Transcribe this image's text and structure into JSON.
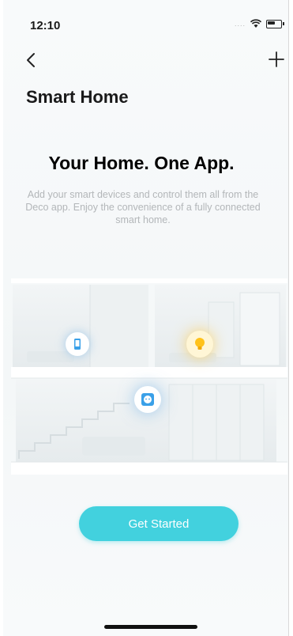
{
  "status_bar": {
    "time": "12:10",
    "signal": "...."
  },
  "nav": {
    "back_icon": "chevron-left-icon",
    "add_icon": "plus-icon"
  },
  "page": {
    "title": "Smart Home",
    "headline": "Your Home. One App.",
    "description": "Add your smart devices and control them all from the Deco app. Enjoy the convenience of a fully connected smart home."
  },
  "illustration": {
    "devices": [
      "smartphone-icon",
      "lightbulb-icon",
      "smart-plug-icon"
    ]
  },
  "actions": {
    "get_started": "Get Started"
  },
  "colors": {
    "accent": "#42d1de",
    "text": "#1a1a1a",
    "muted": "#b3b6b9"
  }
}
